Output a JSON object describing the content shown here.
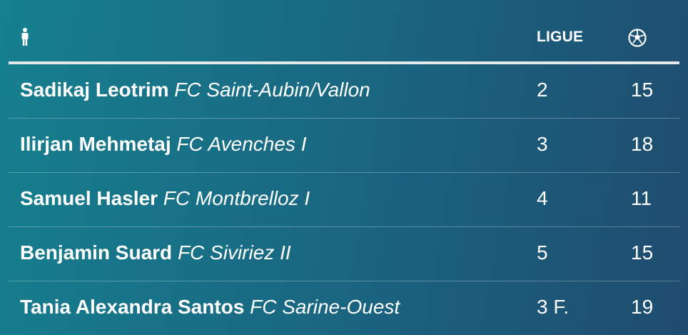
{
  "header": {
    "player_icon": "person-icon",
    "league_label": "LIGUE",
    "goals_icon": "soccer-ball-icon"
  },
  "rows": [
    {
      "name": "Sadikaj Leotrim",
      "club": "FC Saint-Aubin/Vallon",
      "league": "2",
      "goals": "15"
    },
    {
      "name": "Ilirjan Mehmetaj",
      "club": "FC Avenches I",
      "league": "3",
      "goals": "18"
    },
    {
      "name": "Samuel Hasler",
      "club": "FC Montbrelloz I",
      "league": "4",
      "goals": "11"
    },
    {
      "name": "Benjamin Suard",
      "club": "FC Siviriez II",
      "league": "5",
      "goals": "15"
    },
    {
      "name": "Tania Alexandra Santos",
      "club": "FC Sarine-Ouest",
      "league": "3 F.",
      "goals": "19"
    }
  ]
}
